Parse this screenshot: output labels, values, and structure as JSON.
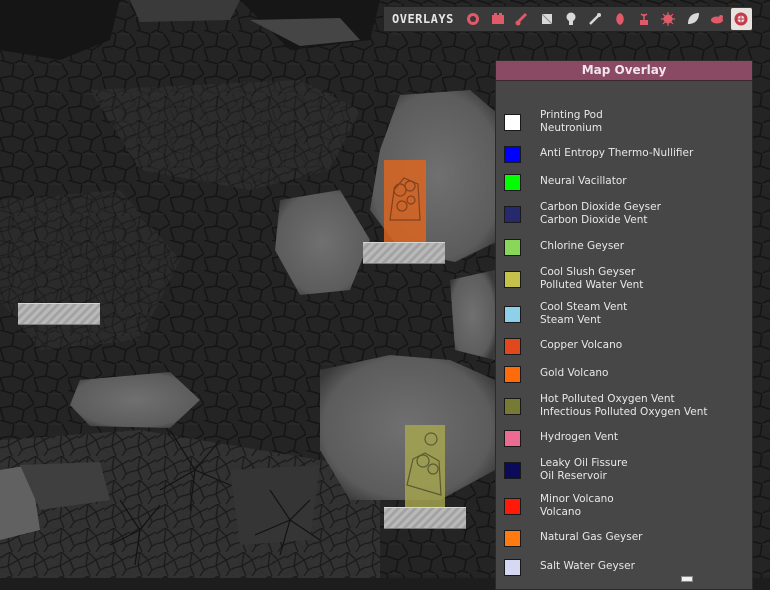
{
  "toolbar": {
    "title": "OVERLAYS",
    "buttons": [
      {
        "name": "oxygen-overlay",
        "icon": "oxygen-icon",
        "color": "#e05a6a"
      },
      {
        "name": "power-overlay",
        "icon": "power-icon",
        "color": "#e05a6a"
      },
      {
        "name": "temperature-overlay",
        "icon": "thermometer-icon",
        "color": "#e05a6a"
      },
      {
        "name": "materials-overlay",
        "icon": "materials-icon",
        "color": "#d8d8d8"
      },
      {
        "name": "light-overlay",
        "icon": "lightbulb-icon",
        "color": "#d8d8d8"
      },
      {
        "name": "plumbing-overlay",
        "icon": "pipe-icon",
        "color": "#d8d8d8"
      },
      {
        "name": "food-overlay",
        "icon": "food-icon",
        "color": "#e05a6a"
      },
      {
        "name": "farming-overlay",
        "icon": "plant-icon",
        "color": "#e05a6a"
      },
      {
        "name": "germs-overlay",
        "icon": "germ-icon",
        "color": "#e05a6a"
      },
      {
        "name": "rooms-overlay",
        "icon": "leaf-icon",
        "color": "#d8d8d8"
      },
      {
        "name": "radiation-overlay",
        "icon": "critter-icon",
        "color": "#e05a6a"
      },
      {
        "name": "map-overlay",
        "icon": "map-icon",
        "color": "#c43a4a",
        "active": true
      }
    ]
  },
  "legend": {
    "title": "Map Overlay",
    "items": [
      {
        "color": "#ffffff",
        "line1": "Printing Pod",
        "line2": "Neutronium"
      },
      {
        "color": "#0000ff",
        "line1": "Anti Entropy Thermo-Nullifier",
        "line2": ""
      },
      {
        "color": "#00ff00",
        "line1": "Neural Vacillator",
        "line2": ""
      },
      {
        "color": "#27296e",
        "line1": "Carbon Dioxide Geyser",
        "line2": "Carbon Dioxide Vent"
      },
      {
        "color": "#8ad65a",
        "line1": "Chlorine Geyser",
        "line2": ""
      },
      {
        "color": "#c4c24a",
        "line1": "Cool Slush Geyser",
        "line2": "Polluted Water Vent"
      },
      {
        "color": "#8ed0ea",
        "line1": "Cool Steam Vent",
        "line2": "Steam Vent"
      },
      {
        "color": "#e2481e",
        "line1": "Copper Volcano",
        "line2": ""
      },
      {
        "color": "#ff6a0a",
        "line1": "Gold Volcano",
        "line2": ""
      },
      {
        "color": "#767a32",
        "line1": "Hot Polluted Oxygen Vent",
        "line2": "Infectious Polluted Oxygen Vent"
      },
      {
        "color": "#ec6b93",
        "line1": "Hydrogen Vent",
        "line2": ""
      },
      {
        "color": "#0b0b5a",
        "line1": "Leaky Oil Fissure",
        "line2": "Oil Reservoir"
      },
      {
        "color": "#ff1a0a",
        "line1": "Minor Volcano",
        "line2": "Volcano"
      },
      {
        "color": "#ff7a10",
        "line1": "Natural Gas Geyser",
        "line2": ""
      },
      {
        "color": "#d6d8f4",
        "line1": "Salt Water Geyser",
        "line2": ""
      }
    ]
  }
}
